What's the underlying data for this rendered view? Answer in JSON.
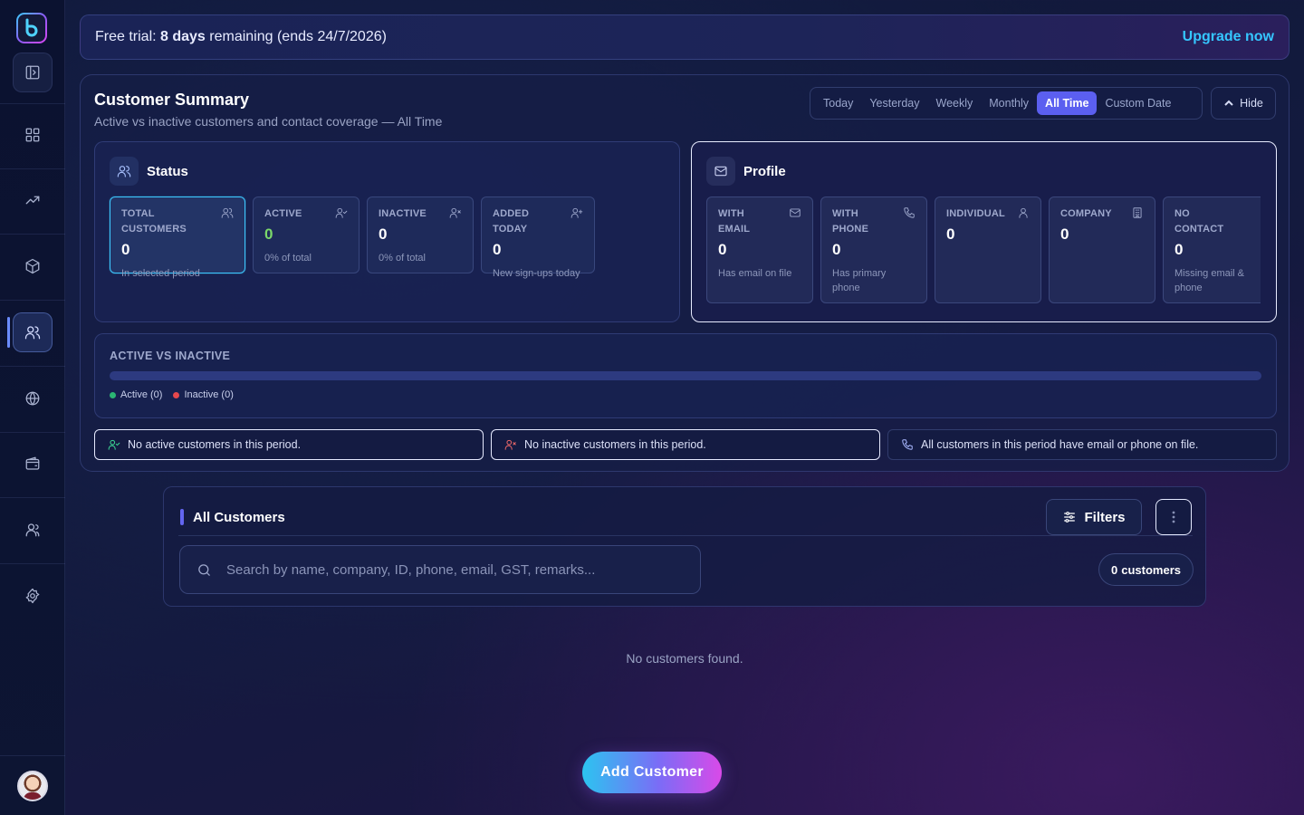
{
  "trial": {
    "prefix": "Free trial: ",
    "days": "8 days",
    "suffix": " remaining (ends 24/7/2026)",
    "upgrade_label": "Upgrade now"
  },
  "summary": {
    "title": "Customer Summary",
    "subtitle": "Active vs inactive customers and contact coverage — All Time",
    "ranges": [
      "Today",
      "Yesterday",
      "Weekly",
      "Monthly",
      "All Time",
      "Custom Date"
    ],
    "selected_range": "All Time",
    "hide_label": "Hide"
  },
  "status": {
    "title": "Status",
    "cards": [
      {
        "label": "TOTAL CUSTOMERS",
        "value": "0",
        "note": "In selected period"
      },
      {
        "label": "ACTIVE",
        "value": "0",
        "note": "0% of total"
      },
      {
        "label": "INACTIVE",
        "value": "0",
        "note": "0% of total"
      },
      {
        "label": "ADDED TODAY",
        "value": "0",
        "note": "New sign-ups today"
      }
    ]
  },
  "profile": {
    "title": "Profile",
    "cards": [
      {
        "label": "WITH EMAIL",
        "value": "0",
        "note": "Has email on file"
      },
      {
        "label": "WITH PHONE",
        "value": "0",
        "note": "Has primary phone"
      },
      {
        "label": "INDIVIDUAL",
        "value": "0",
        "note": ""
      },
      {
        "label": "COMPANY",
        "value": "0",
        "note": ""
      },
      {
        "label": "NO CONTACT",
        "value": "0",
        "note": "Missing email & phone"
      }
    ]
  },
  "active_vs_inactive": {
    "label": "ACTIVE VS INACTIVE",
    "active_fraction": 0,
    "active_legend": "Active (0)",
    "inactive_legend": "Inactive (0)",
    "active_color": "#2bb673",
    "inactive_color": "#e5484d"
  },
  "notices": [
    "No active customers in this period.",
    "No inactive customers in this period.",
    "All customers in this period have email or phone on file."
  ],
  "customers": {
    "title": "All Customers",
    "filters_label": "Filters",
    "search_placeholder": "Search by name, company, ID, phone, email, GST, remarks...",
    "count_value": "0",
    "count_label": "customers",
    "empty_text": "No customers found.",
    "add_label": "Add Customer"
  },
  "sidebar": {
    "icons": [
      "panel-toggle-icon",
      "dashboard-icon",
      "trending-icon",
      "box-icon",
      "users-icon",
      "globe-icon",
      "wallet-icon",
      "team-icon",
      "settings-icon"
    ]
  },
  "colors": {
    "accent": "#5b5ff0",
    "link": "#35c6ff",
    "highlight_border": "#3ec8ff"
  }
}
